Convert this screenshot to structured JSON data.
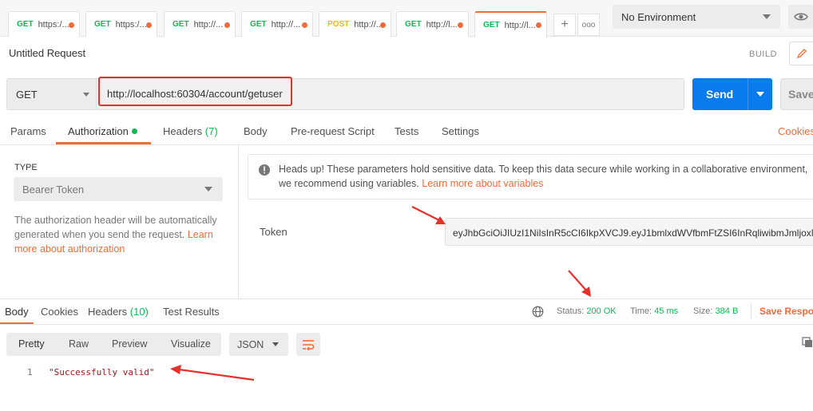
{
  "tabs": [
    {
      "method": "GET",
      "url": "https:/..."
    },
    {
      "method": "GET",
      "url": "https:/..."
    },
    {
      "method": "GET",
      "url": "http://..."
    },
    {
      "method": "GET",
      "url": "http://..."
    },
    {
      "method": "POST",
      "url": "http://..."
    },
    {
      "method": "GET",
      "url": "http://l..."
    },
    {
      "method": "GET",
      "url": "http://l..."
    }
  ],
  "tab_actions": {
    "add": "+",
    "more": "ooo"
  },
  "environment": {
    "selected": "No Environment"
  },
  "request": {
    "title": "Untitled Request",
    "build_label": "BUILD",
    "method": "GET",
    "url": "http://localhost:60304/account/getuser",
    "send_label": "Send",
    "save_label": "Save"
  },
  "request_tabs": {
    "params": "Params",
    "authorization": "Authorization",
    "headers": "Headers",
    "headers_count": "(7)",
    "body": "Body",
    "prerequest": "Pre-request Script",
    "tests": "Tests",
    "settings": "Settings",
    "cookies": "Cookies"
  },
  "auth": {
    "type_label": "TYPE",
    "type_value": "Bearer Token",
    "desc_text": "The authorization header will be automatically generated when you send the request. ",
    "desc_link": "Learn more about authorization",
    "notice_text": "Heads up! These parameters hold sensitive data. To keep this data secure while working in a collaborative environment,",
    "notice_text2": "we recommend using variables. ",
    "notice_link": "Learn more about variables",
    "token_label": "Token",
    "token_value": "eyJhbGciOiJIUzI1NiIsInR5cCI6IkpXVCJ9.eyJ1bmlxdWVfbmFtZSI6InRqliwibmJmljoxN"
  },
  "response_tabs": {
    "body": "Body",
    "cookies": "Cookies",
    "headers": "Headers",
    "headers_count": "(10)",
    "test_results": "Test Results"
  },
  "response_status": {
    "status_label": "Status:",
    "status_value": "200 OK",
    "time_label": "Time:",
    "time_value": "45 ms",
    "size_label": "Size:",
    "size_value": "384 B",
    "save_response": "Save Respon"
  },
  "response_view": {
    "modes": [
      "Pretty",
      "Raw",
      "Preview",
      "Visualize"
    ],
    "format": "JSON"
  },
  "response_body": {
    "line_number": "1",
    "content": "\"Successfully valid\""
  },
  "colors": {
    "accent": "#f26b3a",
    "send": "#097bed",
    "success": "#0cbb52",
    "annotation": "#e8302a"
  }
}
